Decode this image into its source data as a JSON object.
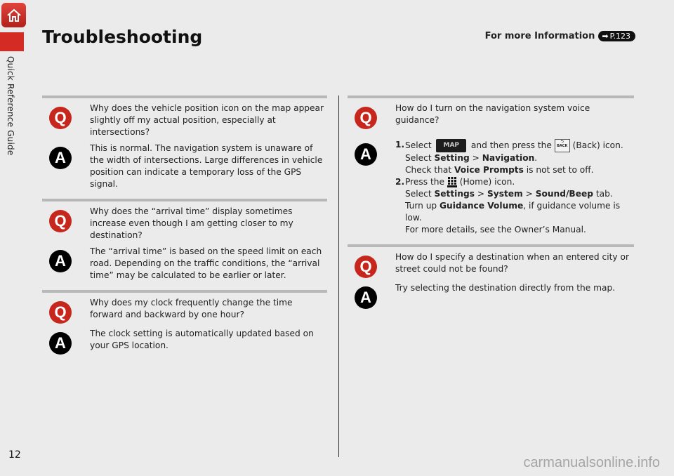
{
  "sidebar": {
    "section_label": "Quick Reference Guide",
    "home_icon": "home-icon"
  },
  "header": {
    "title": "Troubleshooting",
    "more_info_label": "For more Information",
    "page_ref": "P.123"
  },
  "left_column": [
    {
      "q": "Why does the vehicle position icon on the map appear slightly off my actual position, especially at intersections?",
      "a": "This is normal. The navigation system is unaware of the width of intersections. Large differences in vehicle position can indicate a temporary loss of the GPS signal."
    },
    {
      "q": "Why does the “arrival time” display sometimes increase even though I am getting closer to my destination?",
      "a": "The “arrival time” is based on the speed limit on each road. Depending on the traffic conditions, the “arrival time” may be calculated to be earlier or later."
    },
    {
      "q": "Why does my clock frequently change the time forward and backward by one hour?",
      "a": "The clock setting is automatically updated based on your GPS location."
    }
  ],
  "right_column": {
    "qa1": {
      "q": "How do I turn on the navigation system voice guidance?",
      "step1": {
        "num": "1.",
        "select": "Select",
        "map_button": "MAP",
        "then_press": "and then press the",
        "back_icon_label": "BACK",
        "back_text": "(Back) icon.",
        "line2_prefix": "Select",
        "setting": "Setting",
        "sep": ">",
        "navigation": "Navigation",
        "period": ".",
        "line3_prefix": "Check that",
        "voice_prompts": "Voice Prompts",
        "line3_suffix": "is not set to off."
      },
      "step2": {
        "num": "2.",
        "press_the": "Press the",
        "home_text": "(Home) icon.",
        "line2_prefix": "Select",
        "settings": "Settings",
        "sep": ">",
        "system": "System",
        "sound_beep": "Sound/Beep",
        "tab": "tab.",
        "line3_prefix": "Turn up",
        "guidance_volume": "Guidance Volume",
        "line3_suffix": ", if guidance volume is low.",
        "line4": "For more details, see the Owner’s Manual."
      }
    },
    "qa2": {
      "q": "How do I specify a destination when an entered city or street could not be found?",
      "a": "Try selecting the destination directly from the map."
    }
  },
  "badges": {
    "q": "Q",
    "a": "A"
  },
  "footer": {
    "page_number": "12",
    "watermark": "carmanualsonline.info"
  }
}
